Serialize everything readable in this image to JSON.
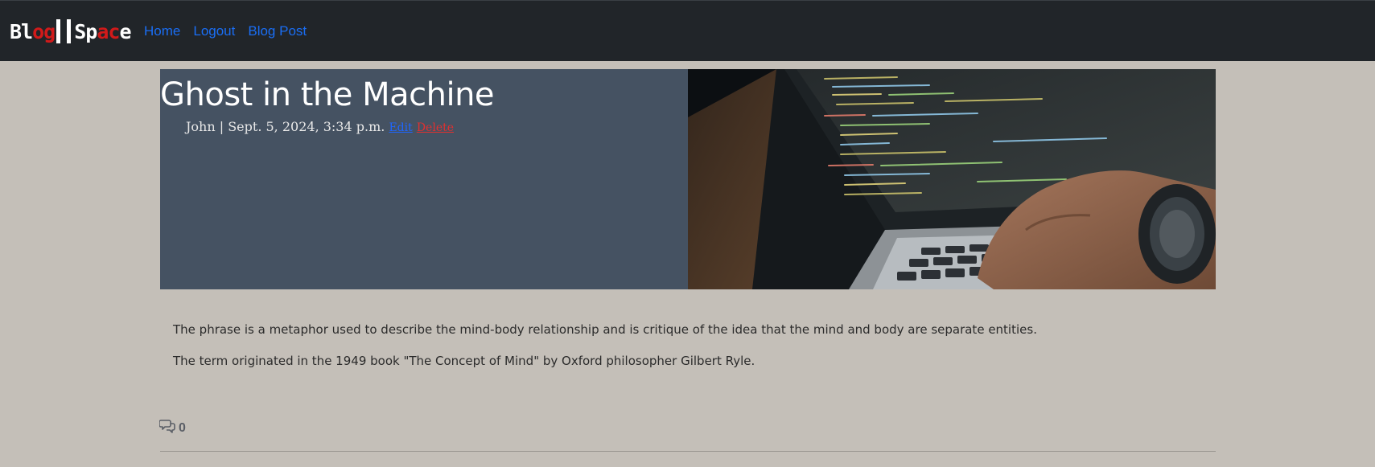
{
  "navbar": {
    "brand": {
      "part1_a": "Bl",
      "part1_b": "og",
      "part2_a": "Sp",
      "part2_b": "ac",
      "part2_c": "e"
    },
    "links": [
      "Home",
      "Logout",
      "Blog Post"
    ]
  },
  "post": {
    "title": "Ghost in the Machine",
    "meta": "John | Sept. 5, 2024, 3:34 p.m.",
    "edit_label": "Edit",
    "delete_label": "Delete",
    "paragraphs": [
      "The phrase is a metaphor used to describe the mind-body relationship and is critique of the idea that the mind and body are separate entities.",
      "The term originated in the 1949 book \"The Concept of Mind\" by Oxford philosopher Gilbert Ryle."
    ],
    "comment_count": "0"
  },
  "colors": {
    "navbar_bg": "#212529",
    "link": "#1a6ef5",
    "brand_red": "#d11a1a",
    "hero_panel": "#455262",
    "delete": "#e03030",
    "page_bg": "#c4bfb8"
  },
  "icons": {
    "comments": "comments-icon",
    "hero_image": "laptop-coding-image"
  }
}
